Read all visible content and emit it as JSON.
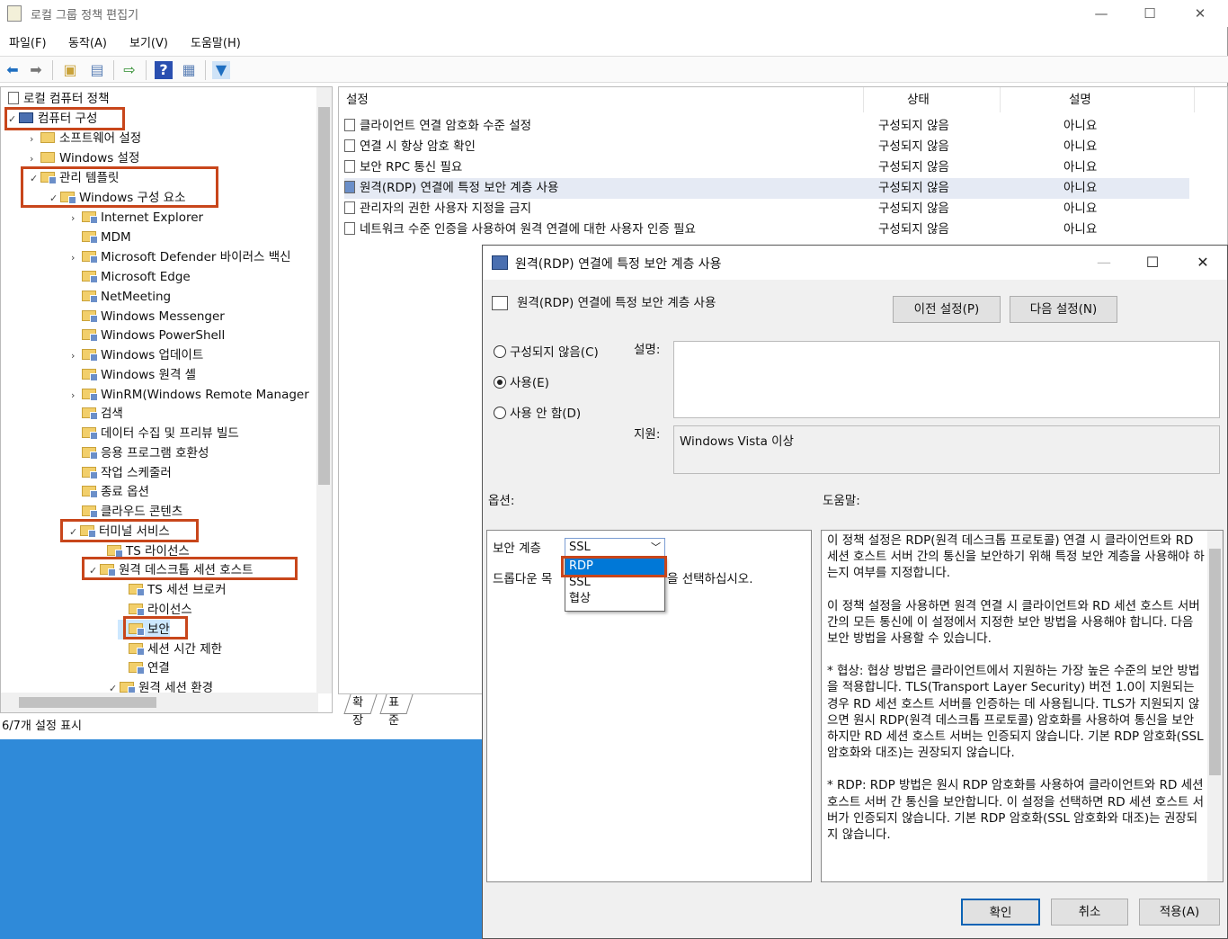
{
  "window": {
    "title": "로컬 그룹 정책 편집기",
    "min": "—",
    "max": "☐",
    "close": "✕"
  },
  "menu": [
    "파일(F)",
    "동작(A)",
    "보기(V)",
    "도움말(H)"
  ],
  "tree": {
    "root": "로컬 컴퓨터 정책",
    "computer": "컴퓨터 구성",
    "software": "소프트웨어 설정",
    "windows_settings": "Windows 설정",
    "admin_templates": "관리 템플릿",
    "win_components": "Windows 구성 요소",
    "ie": "Internet Explorer",
    "mdm": "MDM",
    "defender": "Microsoft Defender 바이러스 백신",
    "edge": "Microsoft Edge",
    "netmeeting": "NetMeeting",
    "messenger": "Windows Messenger",
    "powershell": "Windows PowerShell",
    "update": "Windows 업데이트",
    "remote_shell": "Windows 원격 셸",
    "winrm": "WinRM(Windows Remote Manager",
    "search": "검색",
    "data_collect": "데이터 수집 및 프리뷰 빌드",
    "app_compat": "응용 프로그램 호환성",
    "scheduler": "작업 스케줄러",
    "shutdown": "종료 옵션",
    "cloud": "클라우드 콘텐츠",
    "terminal": "터미널 서비스",
    "ts_license": "TS 라이선스",
    "rdsh": "원격 데스크톱 세션 호스트",
    "ts_broker": "TS 세션 브로커",
    "license": "라이선스",
    "security": "보안",
    "time_limit": "세션 시간 제한",
    "connection": "연결",
    "session_env": "원격 세션 환경"
  },
  "status": "6/7개 설정 표시",
  "list": {
    "headers": [
      "설정",
      "상태",
      "설명"
    ],
    "rows": [
      {
        "name": "클라이언트 연결 암호화 수준 설정",
        "state": "구성되지 않음",
        "comment": "아니요"
      },
      {
        "name": "연결 시 항상 암호 확인",
        "state": "구성되지 않음",
        "comment": "아니요"
      },
      {
        "name": "보안 RPC 통신 필요",
        "state": "구성되지 않음",
        "comment": "아니요"
      },
      {
        "name": "원격(RDP) 연결에 특정 보안 계층 사용",
        "state": "구성되지 않음",
        "comment": "아니요"
      },
      {
        "name": "관리자의 권한 사용자 지정을 금지",
        "state": "구성되지 않음",
        "comment": "아니요"
      },
      {
        "name": "네트워크 수준 인증을 사용하여 원격 연결에 대한 사용자 인증 필요",
        "state": "구성되지 않음",
        "comment": "아니요"
      }
    ]
  },
  "tabs": [
    "확장",
    "표준"
  ],
  "dialog": {
    "title": "원격(RDP) 연결에 특정 보안 계층 사용",
    "heading": "원격(RDP) 연결에 특정 보안 계층 사용",
    "prev": "이전 설정(P)",
    "next": "다음 설정(N)",
    "radio_nc": "구성되지 않음(C)",
    "radio_en": "사용(E)",
    "radio_dis": "사용 안 함(D)",
    "desc_label": "설명:",
    "support_label": "지원:",
    "support": "Windows Vista 이상",
    "options_label": "옵션:",
    "help_label": "도움말:",
    "sec_layer_label": "보안 계층",
    "combo_value": "SSL",
    "dropdown": [
      "RDP",
      "SSL",
      "협상"
    ],
    "option_text_a": "드롭다운 목",
    "option_text_b": "을 선택하십시오.",
    "help_p1": "이 정책 설정은 RDP(원격 데스크톱 프로토콜) 연결 시 클라이언트와 RD 세션 호스트 서버 간의 통신을 보안하기 위해 특정 보안 계층을 사용해야 하는지 여부를 지정합니다.",
    "help_p2": "이 정책 설정을 사용하면 원격 연결 시 클라이언트와 RD 세션 호스트 서버 간의 모든 통신에 이 설정에서 지정한 보안 방법을 사용해야 합니다. 다음 보안 방법을 사용할 수 있습니다.",
    "help_p3": "* 협상: 협상 방법은 클라이언트에서 지원하는 가장 높은 수준의 보안 방법을 적용합니다. TLS(Transport Layer Security) 버전 1.0이 지원되는 경우 RD 세션 호스트 서버를 인증하는 데 사용됩니다. TLS가 지원되지 않으면 원시 RDP(원격 데스크톱 프로토콜) 암호화를 사용하여 통신을 보안하지만 RD 세션 호스트 서버는 인증되지 않습니다. 기본 RDP 암호화(SSL 암호화와 대조)는 권장되지 않습니다.",
    "help_p4": "* RDP: RDP 방법은 원시 RDP 암호화를 사용하여 클라이언트와 RD 세션 호스트 서버 간 통신을 보안합니다. 이 설정을 선택하면 RD 세션 호스트 서버가 인증되지 않습니다. 기본 RDP 암호화(SSL 암호화와 대조)는 권장되지 않습니다.",
    "ok": "확인",
    "cancel": "취소",
    "apply": "적용(A)"
  }
}
